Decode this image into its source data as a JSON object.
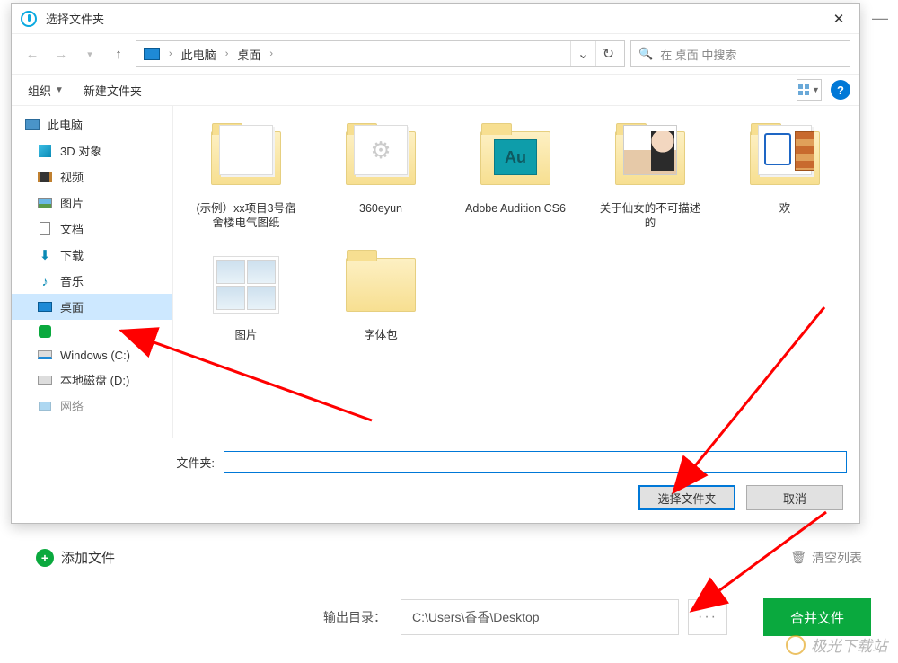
{
  "dialog": {
    "title": "选择文件夹",
    "breadcrumb": {
      "root": "此电脑",
      "current": "桌面"
    },
    "search_placeholder": "在 桌面 中搜索",
    "toolbar": {
      "organize": "组织",
      "new_folder": "新建文件夹"
    },
    "tree": {
      "root": "此电脑",
      "items": [
        {
          "label": "3D 对象",
          "icon": "cube"
        },
        {
          "label": "视频",
          "icon": "video"
        },
        {
          "label": "图片",
          "icon": "picture"
        },
        {
          "label": "文档",
          "icon": "document"
        },
        {
          "label": "下载",
          "icon": "download"
        },
        {
          "label": "音乐",
          "icon": "music"
        },
        {
          "label": "桌面",
          "icon": "desktop",
          "selected": true
        },
        {
          "label": "",
          "icon": "iqiyi"
        },
        {
          "label": "Windows (C:)",
          "icon": "drive"
        },
        {
          "label": "本地磁盘 (D:)",
          "icon": "drive"
        },
        {
          "label": "网络",
          "icon": "network"
        }
      ]
    },
    "folders": [
      {
        "label": "(示例）xx项目3号宿舍楼电气图纸",
        "type": "paper"
      },
      {
        "label": "360eyun",
        "type": "paper-gear"
      },
      {
        "label": "Adobe Audition CS6",
        "type": "app-teal"
      },
      {
        "label": "关于仙女的不可描述的",
        "type": "photo"
      },
      {
        "label": "欢",
        "type": "doc-rar"
      },
      {
        "label": "图片",
        "type": "thumbs"
      },
      {
        "label": "字体包",
        "type": "plain"
      }
    ],
    "form": {
      "folder_label": "文件夹:",
      "folder_value": "",
      "select_btn": "选择文件夹",
      "cancel_btn": "取消"
    }
  },
  "app": {
    "add_file": "添加文件",
    "clear_list": "清空列表",
    "output_label": "输出目录：",
    "output_path": "C:\\Users\\香香\\Desktop",
    "browse": "···",
    "merge_btn": "合并文件"
  },
  "watermark": "极光下载站"
}
